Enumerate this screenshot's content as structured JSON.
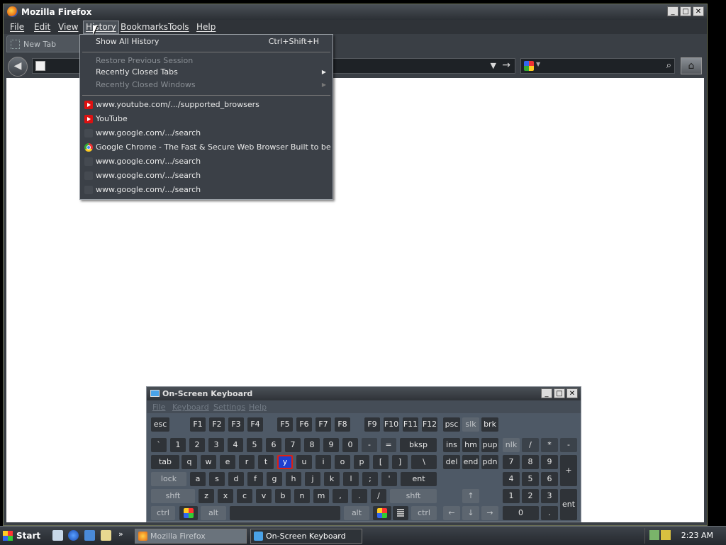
{
  "firefox": {
    "title": "Mozilla Firefox",
    "menus": [
      "File",
      "Edit",
      "View",
      "History",
      "Bookmarks",
      "Tools",
      "Help"
    ],
    "active_menu": "History",
    "tab": {
      "label": "New Tab"
    },
    "url": "",
    "search": ""
  },
  "history_menu": {
    "show_all": {
      "label": "Show All History",
      "shortcut": "Ctrl+Shift+H"
    },
    "restore_session": "Restore Previous Session",
    "recently_closed_tabs": "Recently Closed Tabs",
    "recently_closed_windows": "Recently Closed Windows",
    "entries": [
      {
        "label": "www.youtube.com/.../supported_browsers",
        "icon": "youtube-icon"
      },
      {
        "label": "YouTube",
        "icon": "youtube-icon"
      },
      {
        "label": "www.google.com/.../search",
        "icon": "blank-page-icon"
      },
      {
        "label": "Google Chrome - The Fast & Secure Web Browser Built to be ...",
        "icon": "chrome-icon"
      },
      {
        "label": "www.google.com/.../search",
        "icon": "blank-page-icon"
      },
      {
        "label": "www.google.com/.../search",
        "icon": "blank-page-icon"
      },
      {
        "label": "www.google.com/.../search",
        "icon": "blank-page-icon"
      }
    ]
  },
  "osk": {
    "title": "On-Screen Keyboard",
    "menus": [
      "File",
      "Keyboard",
      "Settings",
      "Help"
    ],
    "keys": {
      "esc": "esc",
      "f": [
        "F1",
        "F2",
        "F3",
        "F4",
        "F5",
        "F6",
        "F7",
        "F8",
        "F9",
        "F10",
        "F11",
        "F12"
      ],
      "psc": "psc",
      "slk": "slk",
      "brk": "brk",
      "num_row": [
        "`",
        "1",
        "2",
        "3",
        "4",
        "5",
        "6",
        "7",
        "8",
        "9",
        "0",
        "-",
        "="
      ],
      "bksp": "bksp",
      "ins": "ins",
      "hm": "hm",
      "pup": "pup",
      "nlk": "nlk",
      "slash": "/",
      "star": "*",
      "minus": "-",
      "tab": "tab",
      "q_row": [
        "q",
        "w",
        "e",
        "r",
        "t",
        "y",
        "u",
        "i",
        "o",
        "p",
        "[",
        "]",
        "\\"
      ],
      "del": "del",
      "end": "end",
      "pdn": "pdn",
      "n7": "7",
      "n8": "8",
      "n9": "9",
      "plus": "+",
      "lock": "lock",
      "a_row": [
        "a",
        "s",
        "d",
        "f",
        "g",
        "h",
        "j",
        "k",
        "l",
        ";",
        "'"
      ],
      "ent": "ent",
      "n4": "4",
      "n5": "5",
      "n6": "6",
      "shft": "shft",
      "z_row": [
        "z",
        "x",
        "c",
        "v",
        "b",
        "n",
        "m",
        ",",
        ".",
        "/"
      ],
      "up": "↑",
      "n1": "1",
      "n2": "2",
      "n3": "3",
      "nent": "ent",
      "ctrl": "ctrl",
      "alt": "alt",
      "left": "←",
      "down": "↓",
      "right": "→",
      "n0": "0",
      "dot": "."
    },
    "highlighted_key": "y"
  },
  "taskbar": {
    "start": "Start",
    "tasks": [
      {
        "label": "Mozilla Firefox",
        "active": true
      },
      {
        "label": "On-Screen Keyboard",
        "active": false
      }
    ],
    "clock": "2:23 AM"
  }
}
